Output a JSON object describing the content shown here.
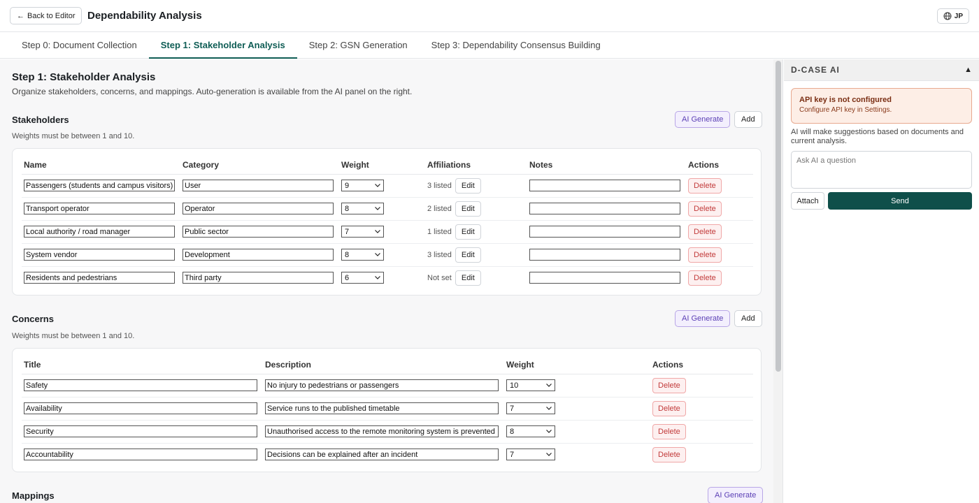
{
  "header": {
    "back_label": "Back to Editor",
    "back_arrow": "←",
    "title": "Dependability Analysis",
    "lang_label": "JP",
    "lang_icon": "globe-icon"
  },
  "tabs": [
    {
      "label": "Step 0: Document Collection",
      "active": false
    },
    {
      "label": "Step 1: Stakeholder Analysis",
      "active": true
    },
    {
      "label": "Step 2: GSN Generation",
      "active": false
    },
    {
      "label": "Step 3: Dependability Consensus Building",
      "active": false
    }
  ],
  "page": {
    "title": "Step 1: Stakeholder Analysis",
    "subtitle": "Organize stakeholders, concerns, and mappings. Auto-generation is available from the AI panel on the right."
  },
  "stakeholders": {
    "title": "Stakeholders",
    "note": "Weights must be between 1 and 10.",
    "ai_label": "AI Generate",
    "add_label": "Add",
    "columns": [
      "Name",
      "Category",
      "Weight",
      "Affiliations",
      "Notes",
      "Actions"
    ],
    "edit_label": "Edit",
    "delete_label": "Delete",
    "rows": [
      {
        "name": "Passengers (students and campus visitors)",
        "category": "User",
        "weight": "9",
        "affiliations": "3 listed",
        "notes": ""
      },
      {
        "name": "Transport operator",
        "category": "Operator",
        "weight": "8",
        "affiliations": "2 listed",
        "notes": ""
      },
      {
        "name": "Local authority / road manager",
        "category": "Public sector",
        "weight": "7",
        "affiliations": "1 listed",
        "notes": ""
      },
      {
        "name": "System vendor",
        "category": "Development",
        "weight": "8",
        "affiliations": "3 listed",
        "notes": ""
      },
      {
        "name": "Residents and pedestrians",
        "category": "Third party",
        "weight": "6",
        "affiliations": "Not set",
        "notes": ""
      }
    ]
  },
  "concerns": {
    "title": "Concerns",
    "note": "Weights must be between 1 and 10.",
    "ai_label": "AI Generate",
    "add_label": "Add",
    "columns": [
      "Title",
      "Description",
      "Weight",
      "Actions"
    ],
    "delete_label": "Delete",
    "rows": [
      {
        "title": "Safety",
        "description": "No injury to pedestrians or passengers",
        "weight": "10"
      },
      {
        "title": "Availability",
        "description": "Service runs to the published timetable",
        "weight": "7"
      },
      {
        "title": "Security",
        "description": "Unauthorised access to the remote monitoring system is prevented",
        "weight": "8"
      },
      {
        "title": "Accountability",
        "description": "Decisions can be explained after an incident",
        "weight": "7"
      }
    ]
  },
  "mappings": {
    "title": "Mappings",
    "ai_label": "AI Generate"
  },
  "sidebar": {
    "title": "D-CASE AI",
    "collapse_glyph": "▲",
    "alert_title": "API key is not configured",
    "alert_desc": "Configure API key in Settings.",
    "info": "AI will make suggestions based on documents and current analysis.",
    "ask_placeholder": "Ask AI a question",
    "attach_label": "Attach",
    "send_label": "Send"
  },
  "colors": {
    "accent": "#0f5d55",
    "send": "#0f4f4a",
    "ai_button": "#5b3fb5",
    "delete": "#c23a3a",
    "alert_bg": "#fdeee6"
  }
}
